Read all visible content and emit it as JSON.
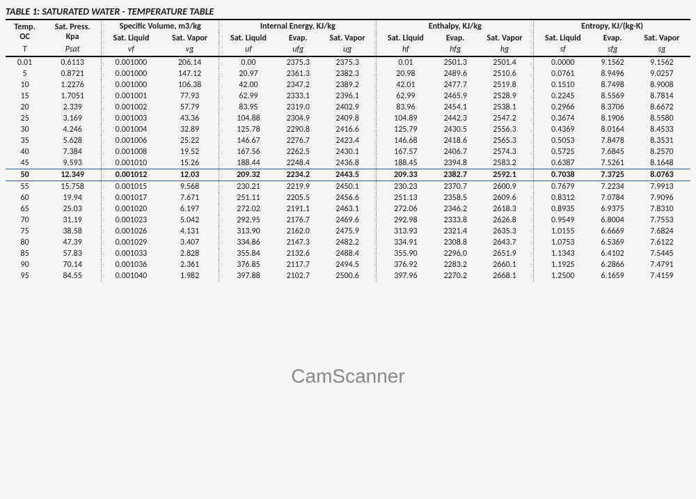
{
  "title": "TABLE 1: SATURATED WATER - TEMPERATURE TABLE",
  "watermark": "CamScanner",
  "groups": {
    "temp": {
      "h1": "Temp.",
      "h2": "OC",
      "sym": "T"
    },
    "psat": {
      "h1": "Sat. Press.",
      "h2": "Kpa",
      "sym": "Psat"
    },
    "sv": {
      "title": "Specific Volume, m3/kg"
    },
    "ie": {
      "title": "Internal Energy, KJ/kg"
    },
    "en": {
      "title": "Enthalpy, KJ/kg"
    },
    "ent": {
      "title": "Entropy, KJ/(kg-K)"
    }
  },
  "subhead": {
    "sl": "Sat. Liquid",
    "sv": "Sat. Vapor",
    "ev": "Evap."
  },
  "syms": {
    "vf": "vf",
    "vg": "vg",
    "uf": "uf",
    "ufg": "ufg",
    "ug": "ug",
    "hf": "hf",
    "hfg": "hfg",
    "hg": "hg",
    "sf": "sf",
    "sfg": "sfg",
    "sg": "sg"
  },
  "highlight_index": 10,
  "rows": [
    {
      "T": "0.01",
      "Psat": "0.6113",
      "vf": "0.001000",
      "vg": "206.14",
      "uf": "0.00",
      "ufg": "2375.3",
      "ug": "2375.3",
      "hf": "0.01",
      "hfg": "2501.3",
      "hg": "2501.4",
      "sf": "0.0000",
      "sfg": "9.1562",
      "sg": "9.1562"
    },
    {
      "T": "5",
      "Psat": "0.8721",
      "vf": "0.001000",
      "vg": "147.12",
      "uf": "20.97",
      "ufg": "2361.3",
      "ug": "2382.3",
      "hf": "20.98",
      "hfg": "2489.6",
      "hg": "2510.6",
      "sf": "0.0761",
      "sfg": "8.9496",
      "sg": "9.0257"
    },
    {
      "T": "10",
      "Psat": "1.2276",
      "vf": "0.001000",
      "vg": "106.38",
      "uf": "42.00",
      "ufg": "2347.2",
      "ug": "2389.2",
      "hf": "42.01",
      "hfg": "2477.7",
      "hg": "2519.8",
      "sf": "0.1510",
      "sfg": "8.7498",
      "sg": "8.9008"
    },
    {
      "T": "15",
      "Psat": "1.7051",
      "vf": "0.001001",
      "vg": "77.93",
      "uf": "62.99",
      "ufg": "2333.1",
      "ug": "2396.1",
      "hf": "62.99",
      "hfg": "2465.9",
      "hg": "2528.9",
      "sf": "0.2245",
      "sfg": "8.5569",
      "sg": "8.7814"
    },
    {
      "T": "20",
      "Psat": "2.339",
      "vf": "0.001002",
      "vg": "57.79",
      "uf": "83.95",
      "ufg": "2319.0",
      "ug": "2402.9",
      "hf": "83.96",
      "hfg": "2454.1",
      "hg": "2538.1",
      "sf": "0.2966",
      "sfg": "8.3706",
      "sg": "8.6672"
    },
    {
      "T": "25",
      "Psat": "3.169",
      "vf": "0.001003",
      "vg": "43.36",
      "uf": "104.88",
      "ufg": "2304.9",
      "ug": "2409.8",
      "hf": "104.89",
      "hfg": "2442.3",
      "hg": "2547.2",
      "sf": "0.3674",
      "sfg": "8.1906",
      "sg": "8.5580"
    },
    {
      "T": "30",
      "Psat": "4.246",
      "vf": "0.001004",
      "vg": "32.89",
      "uf": "125.78",
      "ufg": "2290.8",
      "ug": "2416.6",
      "hf": "125.79",
      "hfg": "2430.5",
      "hg": "2556.3",
      "sf": "0.4369",
      "sfg": "8.0164",
      "sg": "8.4533"
    },
    {
      "T": "35",
      "Psat": "5.628",
      "vf": "0.001006",
      "vg": "25.22",
      "uf": "146.67",
      "ufg": "2276.7",
      "ug": "2423.4",
      "hf": "146.68",
      "hfg": "2418.6",
      "hg": "2565.3",
      "sf": "0.5053",
      "sfg": "7.8478",
      "sg": "8.3531"
    },
    {
      "T": "40",
      "Psat": "7.384",
      "vf": "0.001008",
      "vg": "19.52",
      "uf": "167.56",
      "ufg": "2262.5",
      "ug": "2430.1",
      "hf": "167.57",
      "hfg": "2406.7",
      "hg": "2574.3",
      "sf": "0.5725",
      "sfg": "7.6845",
      "sg": "8.2570"
    },
    {
      "T": "45",
      "Psat": "9.593",
      "vf": "0.001010",
      "vg": "15.26",
      "uf": "188.44",
      "ufg": "2248.4",
      "ug": "2436.8",
      "hf": "188.45",
      "hfg": "2394.8",
      "hg": "2583.2",
      "sf": "0.6387",
      "sfg": "7.5261",
      "sg": "8.1648"
    },
    {
      "T": "50",
      "Psat": "12.349",
      "vf": "0.001012",
      "vg": "12.03",
      "uf": "209.32",
      "ufg": "2234.2",
      "ug": "2443.5",
      "hf": "209.33",
      "hfg": "2382.7",
      "hg": "2592.1",
      "sf": "0.7038",
      "sfg": "7.3725",
      "sg": "8.0763"
    },
    {
      "T": "55",
      "Psat": "15.758",
      "vf": "0.001015",
      "vg": "9.568",
      "uf": "230.21",
      "ufg": "2219.9",
      "ug": "2450.1",
      "hf": "230.23",
      "hfg": "2370.7",
      "hg": "2600.9",
      "sf": "0.7679",
      "sfg": "7.2234",
      "sg": "7.9913"
    },
    {
      "T": "60",
      "Psat": "19.94",
      "vf": "0.001017",
      "vg": "7.671",
      "uf": "251.11",
      "ufg": "2205.5",
      "ug": "2456.6",
      "hf": "251.13",
      "hfg": "2358.5",
      "hg": "2609.6",
      "sf": "0.8312",
      "sfg": "7.0784",
      "sg": "7.9096"
    },
    {
      "T": "65",
      "Psat": "25.03",
      "vf": "0.001020",
      "vg": "6.197",
      "uf": "272.02",
      "ufg": "2191.1",
      "ug": "2463.1",
      "hf": "272.06",
      "hfg": "2346.2",
      "hg": "2618.3",
      "sf": "0.8935",
      "sfg": "6.9375",
      "sg": "7.8310"
    },
    {
      "T": "70",
      "Psat": "31.19",
      "vf": "0.001023",
      "vg": "5.042",
      "uf": "292.95",
      "ufg": "2176.7",
      "ug": "2469.6",
      "hf": "292.98",
      "hfg": "2333.8",
      "hg": "2626.8",
      "sf": "0.9549",
      "sfg": "6.8004",
      "sg": "7.7553"
    },
    {
      "T": "75",
      "Psat": "38.58",
      "vf": "0.001026",
      "vg": "4.131",
      "uf": "313.90",
      "ufg": "2162.0",
      "ug": "2475.9",
      "hf": "313.93",
      "hfg": "2321.4",
      "hg": "2635.3",
      "sf": "1.0155",
      "sfg": "6.6669",
      "sg": "7.6824"
    },
    {
      "T": "80",
      "Psat": "47.39",
      "vf": "0.001029",
      "vg": "3.407",
      "uf": "334.86",
      "ufg": "2147.3",
      "ug": "2482.2",
      "hf": "334.91",
      "hfg": "2308.8",
      "hg": "2643.7",
      "sf": "1.0753",
      "sfg": "6.5369",
      "sg": "7.6122"
    },
    {
      "T": "85",
      "Psat": "57.83",
      "vf": "0.001033",
      "vg": "2.828",
      "uf": "355.84",
      "ufg": "2132.6",
      "ug": "2488.4",
      "hf": "355.90",
      "hfg": "2296.0",
      "hg": "2651.9",
      "sf": "1.1343",
      "sfg": "6.4102",
      "sg": "7.5445"
    },
    {
      "T": "90",
      "Psat": "70.14",
      "vf": "0.001036",
      "vg": "2.361",
      "uf": "376.85",
      "ufg": "2117.7",
      "ug": "2494.5",
      "hf": "376.92",
      "hfg": "2283.2",
      "hg": "2660.1",
      "sf": "1.1925",
      "sfg": "6.2866",
      "sg": "7.4791"
    },
    {
      "T": "95",
      "Psat": "84.55",
      "vf": "0.001040",
      "vg": "1.982",
      "uf": "397.88",
      "ufg": "2102.7",
      "ug": "2500.6",
      "hf": "397.96",
      "hfg": "2270.2",
      "hg": "2668.1",
      "sf": "1.2500",
      "sfg": "6.1659",
      "sg": "7.4159"
    }
  ]
}
